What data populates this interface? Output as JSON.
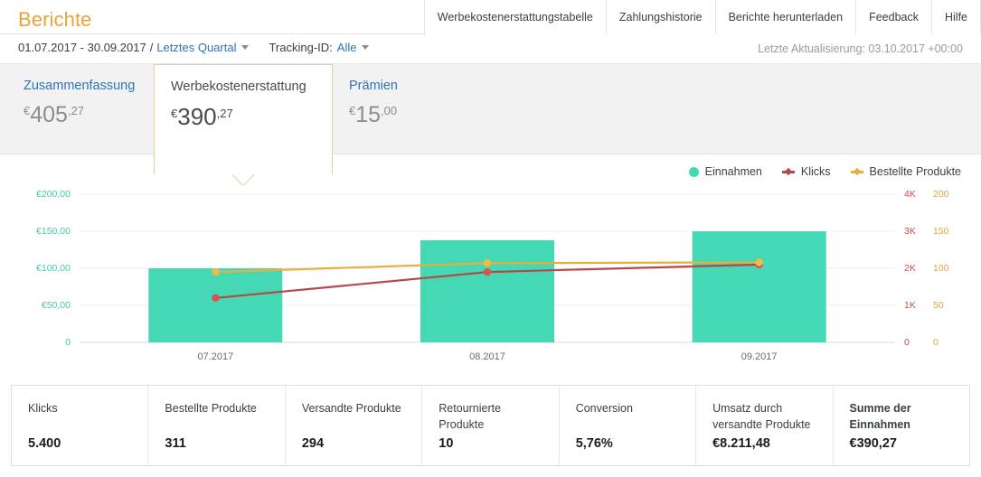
{
  "header": {
    "title": "Berichte",
    "nav_tabs": [
      {
        "label": "Werbekostenerstattungstabelle"
      },
      {
        "label": "Zahlungshistorie"
      },
      {
        "label": "Berichte herunterladen"
      },
      {
        "label": "Feedback"
      },
      {
        "label": "Hilfe"
      }
    ]
  },
  "filters": {
    "date_range": "01.07.2017 - 30.09.2017",
    "separator": "/",
    "preset": "Letztes Quartal",
    "tracking_label": "Tracking-ID:",
    "tracking_value": "Alle",
    "last_update": "Letzte Aktualisierung: 03.10.2017 +00:00"
  },
  "cards": [
    {
      "title": "Zusammenfassung",
      "currency": "€",
      "integer": "405",
      "decimal": ",27",
      "active": false
    },
    {
      "title": "Werbekostenerstattung",
      "currency": "€",
      "integer": "390",
      "decimal": ",27",
      "active": true
    },
    {
      "title": "Prämien",
      "currency": "€",
      "integer": "15",
      "decimal": ",00",
      "active": false
    }
  ],
  "colors": {
    "brand_orange": "#e8a33d",
    "link_blue": "#2f73b8",
    "revenue_teal": "#45d8b5",
    "clicks_red": "#b8464a",
    "orders_gold": "#e5b040",
    "card_border": "#e0cfa0"
  },
  "chart_data": {
    "type": "bar",
    "title": "",
    "categories": [
      "07.2017",
      "08.2017",
      "09.2017"
    ],
    "legend_position": "top-right",
    "grid": true,
    "series": [
      {
        "name": "Einnahmen",
        "type": "bar",
        "axis": "left",
        "color": "#45d8b5",
        "values": [
          100.0,
          138.0,
          150.0
        ]
      },
      {
        "name": "Klicks",
        "type": "line",
        "axis": "right1",
        "color": "#b8464a",
        "values": [
          1200,
          1900,
          2100
        ]
      },
      {
        "name": "Bestellte Produkte",
        "type": "line",
        "axis": "right2",
        "color": "#e5b040",
        "values": [
          95,
          107,
          108
        ]
      }
    ],
    "axes": {
      "left": {
        "label": "",
        "color": "#43c9a8",
        "ticks": [
          "0",
          "€50,00",
          "€100,00",
          "€150,00",
          "€200,00"
        ],
        "min": 0,
        "max": 200
      },
      "right1": {
        "label": "",
        "color": "#c0504d",
        "ticks": [
          "0",
          "1K",
          "2K",
          "3K",
          "4K"
        ],
        "min": 0,
        "max": 4000
      },
      "right2": {
        "label": "",
        "color": "#d6a83a",
        "ticks": [
          "0",
          "50",
          "100",
          "150",
          "200"
        ],
        "min": 0,
        "max": 200
      }
    }
  },
  "metrics": [
    {
      "label": "Klicks",
      "value": "5.400",
      "emphasis": false
    },
    {
      "label": "Bestellte Produkte",
      "value": "311",
      "emphasis": false
    },
    {
      "label": "Versandte Produkte",
      "value": "294",
      "emphasis": false
    },
    {
      "label": "Retournierte Produkte",
      "value": "10",
      "emphasis": false
    },
    {
      "label": "Conversion",
      "value": "5,76%",
      "emphasis": false
    },
    {
      "label": "Umsatz durch versandte Produkte",
      "value": "€8.211,48",
      "emphasis": false
    },
    {
      "label": "Summe der Einnahmen",
      "value": "€390,27",
      "emphasis": true
    }
  ]
}
